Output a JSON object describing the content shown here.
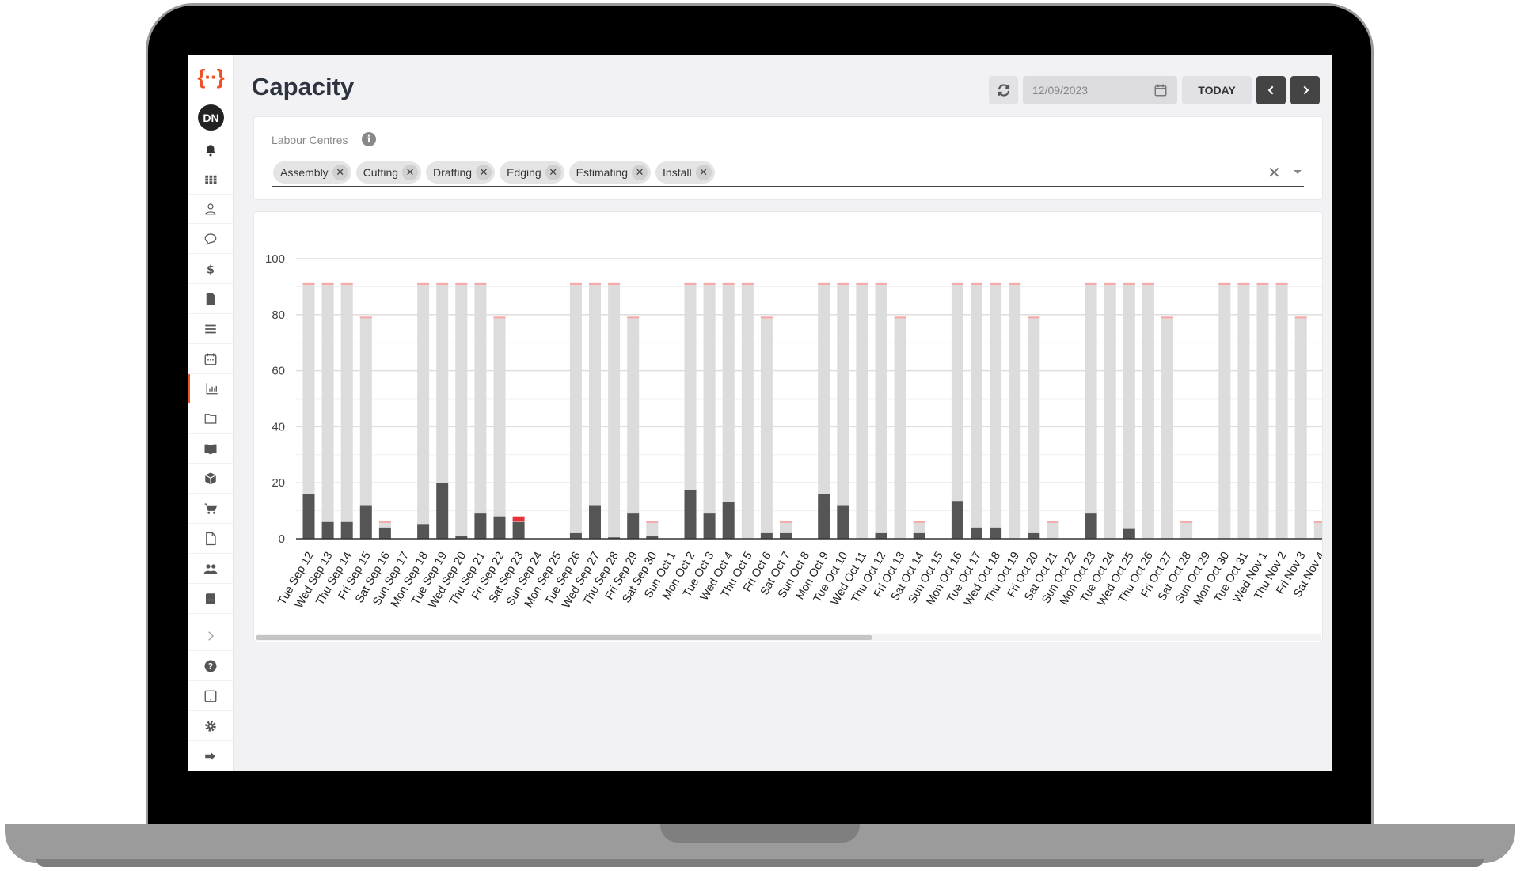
{
  "app": {
    "logo_text": "{··}",
    "page_title": "Capacity",
    "user_initials": "DN"
  },
  "sidebar": {
    "items": [
      {
        "icon": "bell-icon"
      },
      {
        "icon": "grid-icon"
      },
      {
        "icon": "user-icon"
      },
      {
        "icon": "chat-icon"
      },
      {
        "icon": "dollar-icon"
      },
      {
        "icon": "file-icon"
      },
      {
        "icon": "list-icon"
      },
      {
        "icon": "calendar-icon"
      },
      {
        "icon": "bar-chart-icon",
        "active": true
      },
      {
        "icon": "folder-icon"
      },
      {
        "icon": "book-icon"
      },
      {
        "icon": "box-icon"
      },
      {
        "icon": "cart-icon"
      },
      {
        "icon": "document-icon"
      },
      {
        "icon": "users-icon"
      },
      {
        "icon": "notebook-icon"
      }
    ],
    "bottom": [
      {
        "icon": "chevron-right-icon"
      },
      {
        "icon": "help-icon"
      },
      {
        "icon": "tablet-icon"
      },
      {
        "icon": "gear-icon"
      },
      {
        "icon": "logout-icon"
      }
    ]
  },
  "toolbar": {
    "date_value": "12/09/2023",
    "today_label": "TODAY"
  },
  "filter": {
    "label": "Labour Centres",
    "chips": [
      "Assembly",
      "Cutting",
      "Drafting",
      "Edging",
      "Estimating",
      "Install"
    ]
  },
  "colors": {
    "used": "#555555",
    "remaining": "#dcdcdc",
    "over": "#e8323a",
    "cap": "#f7a6a6",
    "accent": "#f05a28"
  },
  "chart_data": {
    "type": "bar",
    "stacked": true,
    "ylim": [
      0,
      100
    ],
    "yticks": [
      0,
      20,
      40,
      60,
      80,
      100
    ],
    "grid": true,
    "categories": [
      "Tue Sep 12",
      "Wed Sep 13",
      "Thu Sep 14",
      "Fri Sep 15",
      "Sat Sep 16",
      "Sun Sep 17",
      "Mon Sep 18",
      "Tue Sep 19",
      "Wed Sep 20",
      "Thu Sep 21",
      "Fri Sep 22",
      "Sat Sep 23",
      "Sun Sep 24",
      "Mon Sep 25",
      "Tue Sep 26",
      "Wed Sep 27",
      "Thu Sep 28",
      "Fri Sep 29",
      "Sat Sep 30",
      "Sun Oct 1",
      "Mon Oct 2",
      "Tue Oct 3",
      "Wed Oct 4",
      "Thu Oct 5",
      "Fri Oct 6",
      "Sat Oct 7",
      "Sun Oct 8",
      "Mon Oct 9",
      "Tue Oct 10",
      "Wed Oct 11",
      "Thu Oct 12",
      "Fri Oct 13",
      "Sat Oct 14",
      "Sun Oct 15",
      "Mon Oct 16",
      "Tue Oct 17",
      "Wed Oct 18",
      "Thu Oct 19",
      "Fri Oct 20",
      "Sat Oct 21",
      "Sun Oct 22",
      "Mon Oct 23",
      "Tue Oct 24",
      "Wed Oct 25",
      "Thu Oct 26",
      "Fri Oct 27",
      "Sat Oct 28",
      "Sun Oct 29",
      "Mon Oct 30",
      "Tue Oct 31",
      "Wed Nov 1",
      "Thu Nov 2",
      "Fri Nov 3",
      "Sat Nov 4"
    ],
    "capacity": [
      91,
      91,
      91,
      79,
      6,
      0,
      91,
      91,
      91,
      91,
      79,
      6,
      0,
      0,
      91,
      91,
      91,
      79,
      6,
      0,
      91,
      91,
      91,
      91,
      79,
      6,
      0,
      91,
      91,
      91,
      91,
      79,
      6,
      0,
      91,
      91,
      91,
      91,
      79,
      6,
      0,
      91,
      91,
      91,
      91,
      79,
      6,
      0,
      91,
      91,
      91,
      91,
      79,
      6
    ],
    "used": [
      16,
      6,
      6,
      12,
      4,
      0,
      5,
      20,
      1,
      9,
      8,
      6,
      0,
      0,
      2,
      12,
      0.5,
      9,
      1,
      0,
      17.5,
      9,
      13,
      0,
      2,
      2,
      0,
      16,
      12,
      0,
      2,
      0,
      2,
      0,
      13.5,
      4,
      4,
      0,
      2,
      0,
      0,
      9,
      0,
      3.5,
      0,
      0,
      0,
      0,
      0,
      0,
      0,
      0,
      0,
      0
    ],
    "over": [
      0,
      0,
      0,
      0,
      0,
      0,
      0,
      0,
      0,
      0,
      0,
      2,
      0,
      0,
      0,
      0,
      0,
      0,
      0,
      0,
      0,
      0,
      0,
      0,
      0,
      0,
      0,
      0,
      0,
      0,
      0,
      0,
      0,
      0,
      0,
      0,
      0,
      0,
      0,
      0,
      0,
      0,
      0,
      0,
      0,
      0,
      0,
      0,
      0,
      0,
      0,
      0,
      0,
      0
    ]
  }
}
